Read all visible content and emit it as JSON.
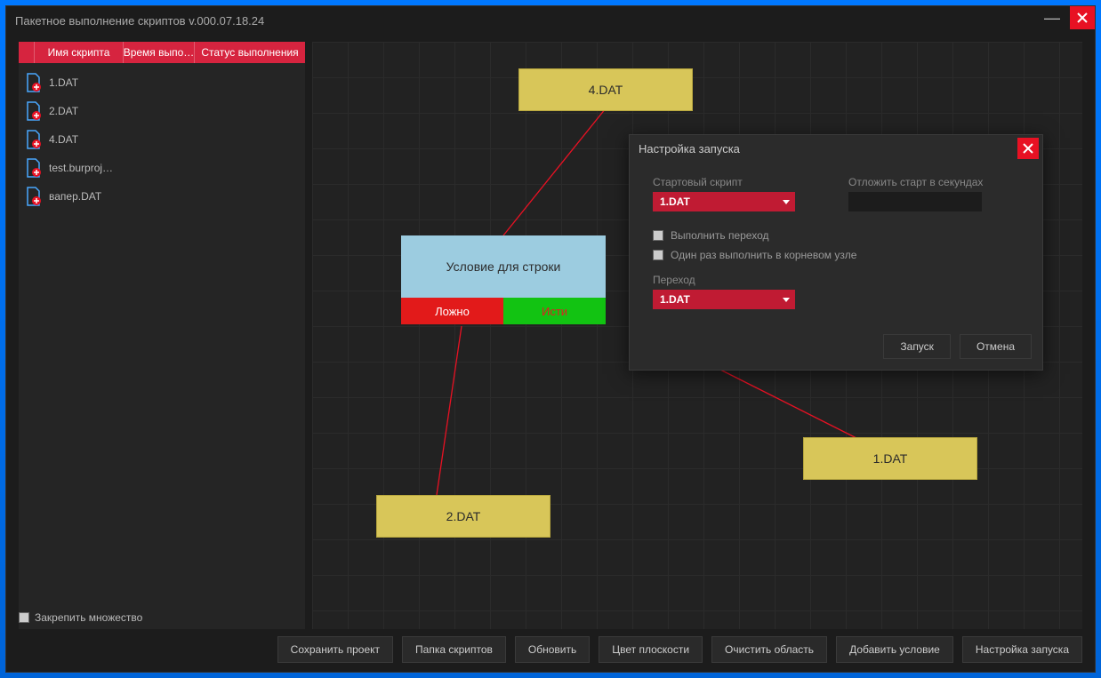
{
  "window": {
    "title": "Пакетное выполнение скриптов v.000.07.18.24"
  },
  "sidebar": {
    "columns": {
      "name": "Имя скрипта",
      "time": "Время выпо…",
      "status": "Статус выполнения"
    },
    "items": [
      {
        "label": "1.DAT"
      },
      {
        "label": "2.DAT"
      },
      {
        "label": "4.DAT"
      },
      {
        "label": "test.burproj…"
      },
      {
        "label": "вапер.DAT"
      }
    ]
  },
  "pin_label": "Закрепить множество",
  "canvas": {
    "node_4dat": "4.DAT",
    "node_2dat": "2.DAT",
    "node_1dat": "1.DAT",
    "condition_title": "Условие для строки",
    "cond_false": "Ложно",
    "cond_true": "Исти"
  },
  "dialog": {
    "title": "Настройка запуска",
    "start_script_label": "Стартовый скрипт",
    "start_script_value": "1.DAT",
    "delay_label": "Отложить старт в секундах",
    "chk_go": "Выполнить переход",
    "chk_once": "Один раз выполнить в корневом узле",
    "transition_label": "Переход",
    "transition_value": "1.DAT",
    "launch": "Запуск",
    "cancel": "Отмена"
  },
  "buttons": {
    "save": "Сохранить проект",
    "folder": "Папка скриптов",
    "refresh": "Обновить",
    "planecolor": "Цвет плоскости",
    "clear": "Очистить область",
    "addcond": "Добавить условие",
    "launchcfg": "Настройка запуска"
  }
}
